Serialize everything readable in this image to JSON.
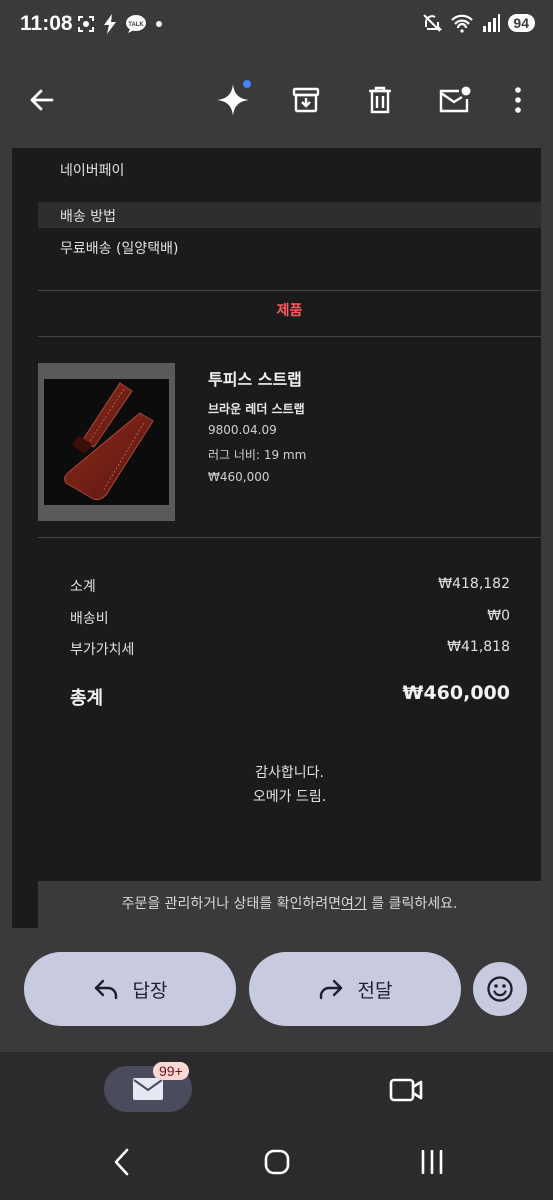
{
  "status": {
    "time": "11:08",
    "battery": "94"
  },
  "email": {
    "payment_value": "네이버페이",
    "shipping_heading": "배송 방법",
    "shipping_value": "무료배송 (일양택배)",
    "product_tab": "제품",
    "product": {
      "name": "투피스 스트랩",
      "subtitle": "브라운 레더 스트랩",
      "code": "9800.04.09",
      "lug": "러그 너비: 19 mm",
      "price": "₩460,000"
    },
    "summary": {
      "subtotal_label": "소계",
      "subtotal_value": "₩418,182",
      "shipping_label": "배송비",
      "shipping_value": "₩0",
      "vat_label": "부가가치세",
      "vat_value": "₩41,818",
      "total_label": "총계",
      "total_value": "₩460,000"
    },
    "thanks_line1": "감사합니다.",
    "thanks_line2": "오메가 드림.",
    "footer_before": "주문을 관리하거나 상태를 확인하려면",
    "footer_link": "여기",
    "footer_after": " 를 클릭하세요."
  },
  "actions": {
    "reply": "답장",
    "forward": "전달"
  },
  "nav": {
    "mail_badge": "99+"
  },
  "colors": {
    "accent_red": "#ff5a5f",
    "pill": "#c8cae0",
    "gem_dot": "#4285f4"
  }
}
